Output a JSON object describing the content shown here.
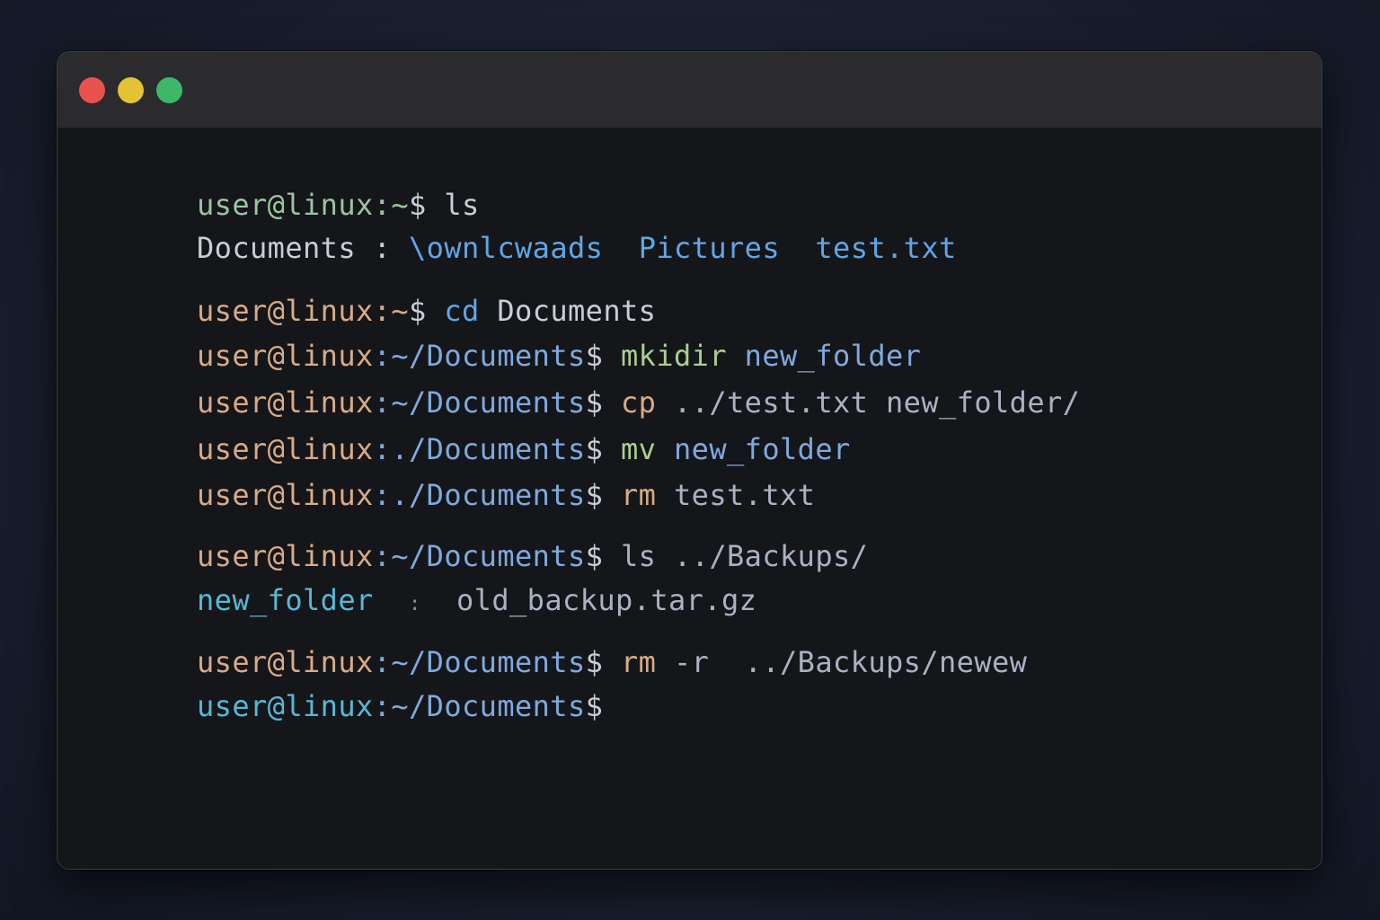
{
  "window": {
    "controls": {
      "close_color": "#e8534d",
      "minimize_color": "#e3c234",
      "zoom_color": "#3cb867"
    }
  },
  "colors": {
    "prompt_green": "#9bc4a0",
    "prompt_orange": "#d8ab86",
    "prompt_cyan": "#56b9d6",
    "path_blue": "#7ea9e0",
    "command_green": "#a9cf8f",
    "dir_blue": "#5fa6e6",
    "text_light": "#c8cdd6",
    "text_dim": "#a9b2c4"
  },
  "terminal": {
    "lines": [
      {
        "prompt_user": "user@linux",
        "prompt_path": ":~",
        "prompt_symbol": "$",
        "command": "ls",
        "args": ""
      },
      {
        "output": [
          "Documents",
          ":",
          "\\ownlcwaads",
          "Pictures",
          "test.txt"
        ]
      },
      {
        "prompt_user": "user@linux",
        "prompt_path": ":~",
        "prompt_symbol": "$",
        "command": "cd",
        "args": "Documents"
      },
      {
        "prompt_user": "user@linux",
        "prompt_path": ":~/Documents",
        "prompt_symbol": "$",
        "command": "mkidir",
        "args": "new_folder"
      },
      {
        "prompt_user": "user@linux",
        "prompt_path": ":~/Documents",
        "prompt_symbol": "$",
        "command": "cp",
        "args": "../test.txt new_folder/"
      },
      {
        "prompt_user": "user@linux",
        "prompt_path": ":./Documents",
        "prompt_symbol": "$",
        "command": "mv",
        "args": "new_folder"
      },
      {
        "prompt_user": "user@linux",
        "prompt_path": ":./Documents",
        "prompt_symbol": "$",
        "command": "rm",
        "args": "test.txt"
      },
      {
        "prompt_user": "user@linux",
        "prompt_path": ":~/Documents",
        "prompt_symbol": "$",
        "command": "ls",
        "args": "../Backups/"
      },
      {
        "output": [
          "new_folder",
          ":",
          "old_backup.tar.gz"
        ]
      },
      {
        "prompt_user": "user@linux",
        "prompt_path": ":~/Documents",
        "prompt_symbol": "$",
        "command": "rm",
        "args": "-r  ../Backups/newew"
      },
      {
        "prompt_user": "user@linux",
        "prompt_path": ":~/Documents",
        "prompt_symbol": "$",
        "command": "",
        "args": ""
      }
    ]
  }
}
